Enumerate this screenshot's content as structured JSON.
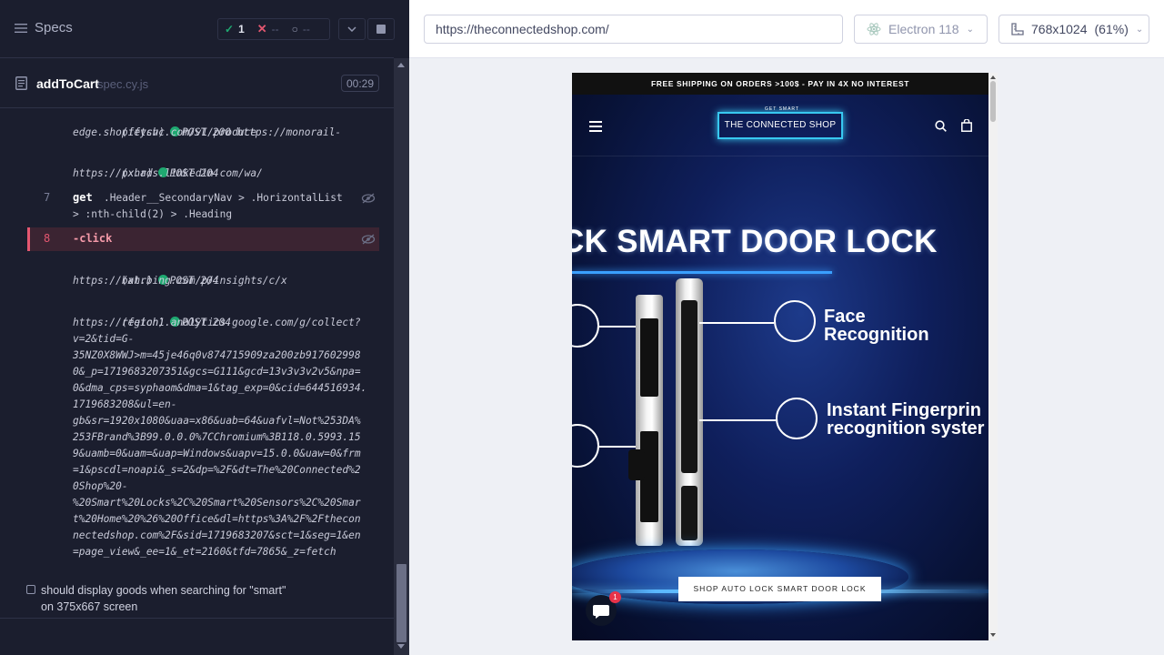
{
  "reporter": {
    "specs_label": "Specs",
    "stats": {
      "passed": "1",
      "failed": "--",
      "pending": "--"
    },
    "spec": {
      "name": "addToCart",
      "file": "spec.cy.js",
      "timer": "00:29"
    },
    "log": {
      "entry1": {
        "type": "(fetch)",
        "method": "POST 200 https://monorail-",
        "url": "edge.shopifysvc.com/v1/produce"
      },
      "entry2": {
        "type": "(xhr)",
        "method": "POST 204",
        "url": "https://px.ads.linkedin.com/wa/"
      },
      "cmd7": {
        "num": "7",
        "name": "get",
        "sel1": ".Header__SecondaryNav > .HorizontalList",
        "sel2": "> :nth-child(2) > .Heading"
      },
      "cmd8": {
        "num": "8",
        "name": "-click"
      },
      "entry3": {
        "type": "(xhr)",
        "method": "POST 204",
        "url": "https://bat.bing.com/p/insights/c/x"
      },
      "entry4": {
        "type": "(fetch)",
        "method": "POST 204",
        "lines": [
          "https://region1.analytics.google.com/g/collect?",
          "v=2&tid=G-",
          "35NZ0X8WWJ>m=45je46q0v874715909za200zb917602998",
          "0&_p=1719683207351&gcs=G111&gcd=13v3v3v2v5&npa=",
          "0&dma_cps=syphaom&dma=1&tag_exp=0&cid=644516934.",
          "1719683208&ul=en-",
          "gb&sr=1920x1080&uaa=x86&uab=64&uafvl=Not%253DA%",
          "253FBrand%3B99.0.0.0%7CChromium%3B118.0.5993.15",
          "9&uamb=0&uam=&uap=Windows&uapv=15.0.0&uaw=0&frm",
          "=1&pscdl=noapi&_s=2&dp=%2F&dt=The%20Connected%2",
          "0Shop%20-",
          "%20Smart%20Locks%2C%20Smart%20Sensors%2C%20Smar",
          "t%20Home%20%26%20Office&dl=https%3A%2F%2Fthecon",
          "nectedshop.com%2F&sid=1719683207&sct=1&seg=1&en",
          "=page_view&_ee=1&_et=2160&tfd=7865&_z=fetch"
        ]
      }
    },
    "next_test": {
      "line1": "should display goods when searching for \"smart\"",
      "line2": "on 375x667 screen"
    }
  },
  "aut": {
    "url": "https://theconnectedshop.com/",
    "browser": "Electron 118",
    "viewport": "768x1024",
    "viewport_scale": "(61%)",
    "site": {
      "announcement": "FREE SHIPPING ON ORDERS >100$ - PAY IN 4X NO INTEREST",
      "logo_tagline": "GET SMART",
      "logo": "THE CONNECTED SHOP",
      "hero_title": "CK SMART DOOR LOCK",
      "feature1_line1": "Face",
      "feature1_line2": "Recognition",
      "feature2_line1": "Instant Fingerprin",
      "feature2_line2": "recognition syster",
      "cta": "SHOP AUTO LOCK SMART DOOR LOCK",
      "chat_badge": "1"
    }
  }
}
